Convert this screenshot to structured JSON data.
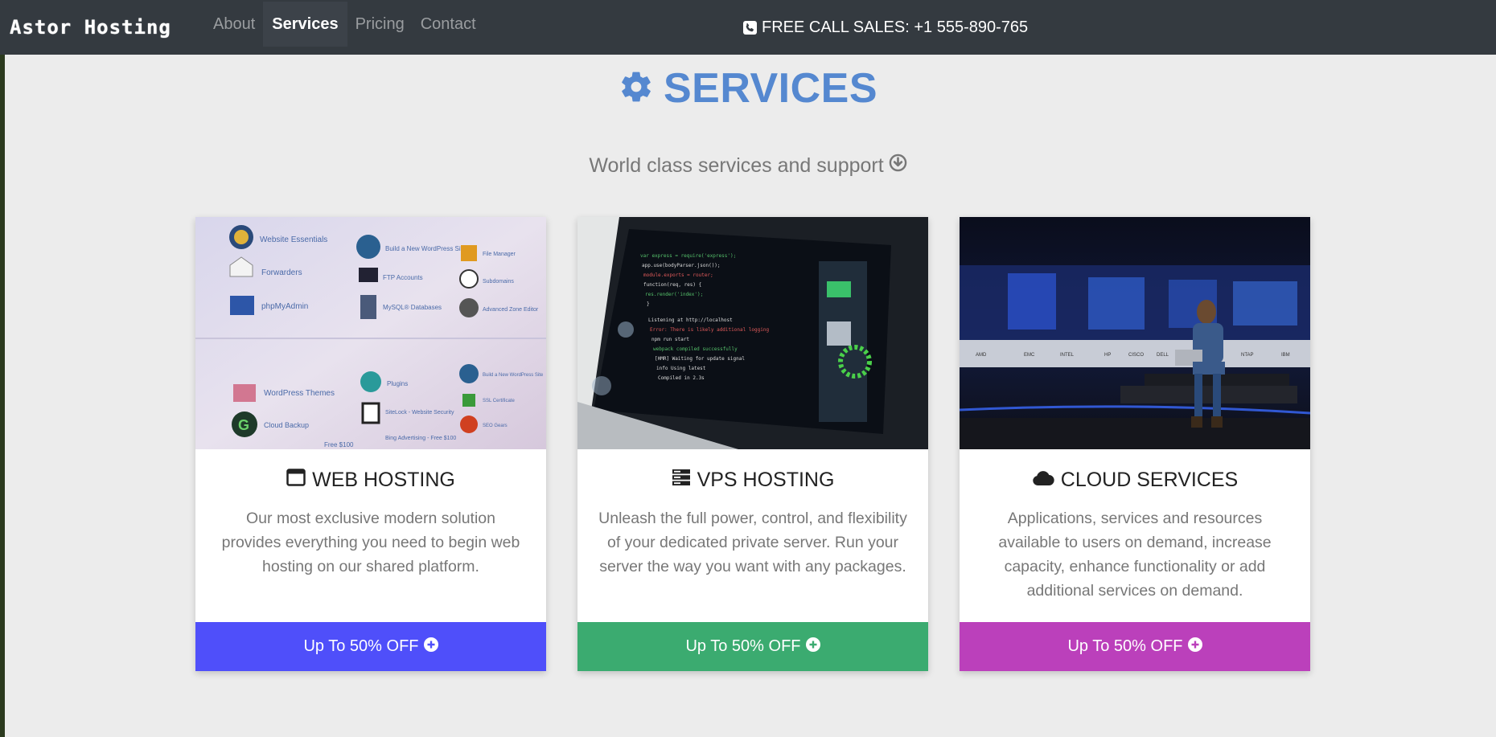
{
  "navbar": {
    "brand": "Astor Hosting",
    "links": [
      {
        "label": "About"
      },
      {
        "label": "Services"
      },
      {
        "label": "Pricing"
      },
      {
        "label": "Contact"
      }
    ],
    "active": "Services",
    "sales": "FREE CALL SALES: +1 555-890-765",
    "sales_icon": "phone-square-icon"
  },
  "heading": {
    "title": "SERVICES",
    "icon": "gear-icon",
    "subtitle": "World class services and support",
    "subtitle_icon": "circle-arrow-down-icon"
  },
  "cards": [
    {
      "title": "WEB HOSTING",
      "icon": "window-icon",
      "image": "hosting-control-panel-photo",
      "description": "Our most exclusive modern solution provides everything you need to begin web hosting on our shared platform.",
      "button": "Up To 50% OFF",
      "button_icon": "plus-circle-icon",
      "color": "#4f4ffa"
    },
    {
      "title": "VPS HOSTING",
      "icon": "server-icon",
      "image": "laptop-code-photo",
      "description": "Unleash the full power, control, and flexibility of your dedicated private server. Run your server the way you want with any packages.",
      "button": "Up To 50% OFF",
      "button_icon": "plus-circle-icon",
      "color": "#3bab70"
    },
    {
      "title": "CLOUD SERVICES",
      "icon": "cloud-icon",
      "image": "datacenter-woman-laptop-photo",
      "description": "Applications, services and resources available to users on demand, increase capacity, enhance functionality or add additional services on demand.",
      "button": "Up To 50% OFF",
      "button_icon": "plus-circle-icon",
      "color": "#bb40bb"
    }
  ],
  "colors": {
    "navbar_bg": "#343a40",
    "heading": "#5588d0",
    "page_bg": "#ececec"
  }
}
